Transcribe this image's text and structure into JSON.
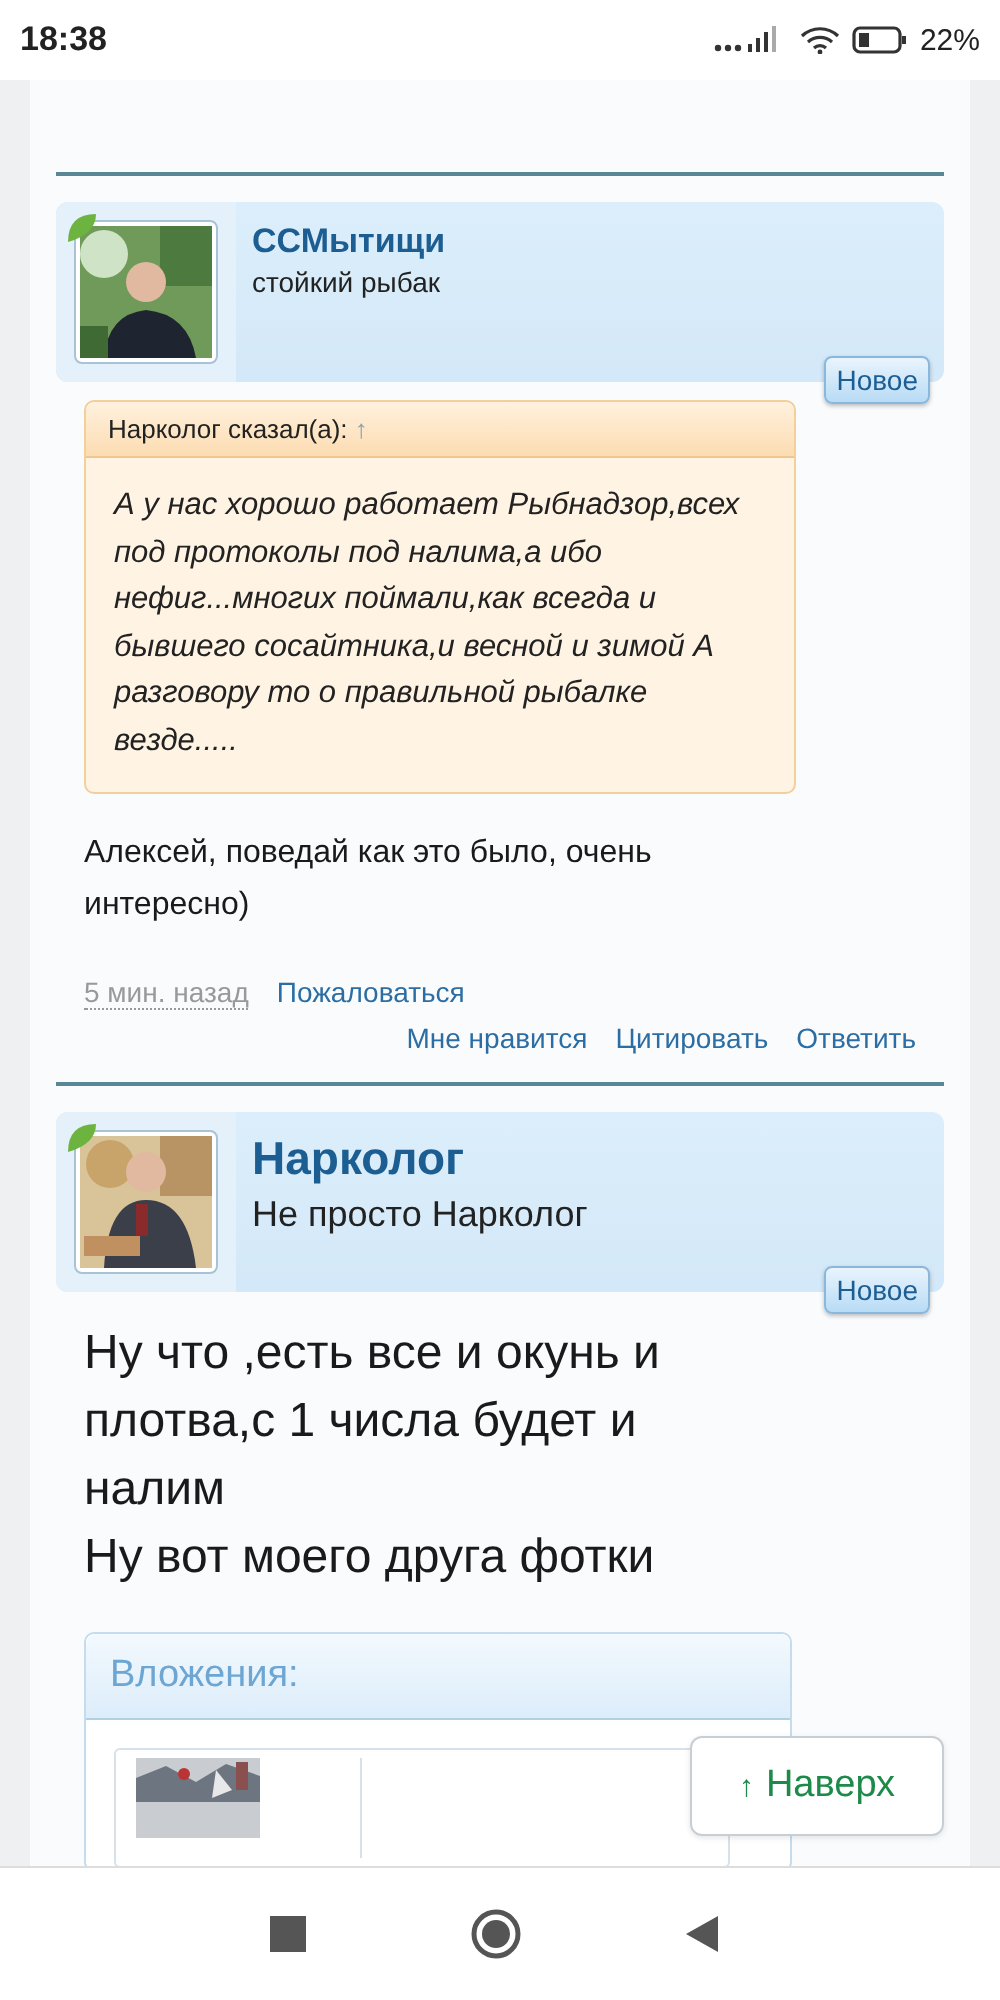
{
  "status_bar": {
    "time": "18:38",
    "battery": "22%"
  },
  "posts": [
    {
      "author": "ССМытищи",
      "user_title": "стойкий рыбак",
      "online": true,
      "new_label": "Новое",
      "kind": "normal",
      "quote": {
        "header": "Нарколог сказал(а):",
        "link": "↑",
        "text": "А у нас хорошо работает Рыбнадзор,всех под протоколы под налима,а ибо нефиг...многих поймали,как всегда и бывшего сосайтника,и весной и зимой А разговору то о правильной рыбалке везде....."
      },
      "message": [
        "Алексей, поведай как это было, очень интересно)"
      ],
      "time": "5 мин. назад",
      "report": "Пожаловаться",
      "links": [
        "Мне нравится",
        "Цитировать",
        "Ответить"
      ]
    },
    {
      "author": "Нарколог",
      "user_title": "Не просто Нарколог",
      "online": true,
      "new_label": "Новое",
      "kind": "large",
      "message": [
        "Ну что ,есть все и окунь и плотва,с 1 числа будет и налим",
        "Ну вот моего друга фотки"
      ],
      "attachments": {
        "title": "Вложения:"
      }
    }
  ],
  "scroll_top": {
    "arrow": "↑",
    "label": "Наверх"
  }
}
